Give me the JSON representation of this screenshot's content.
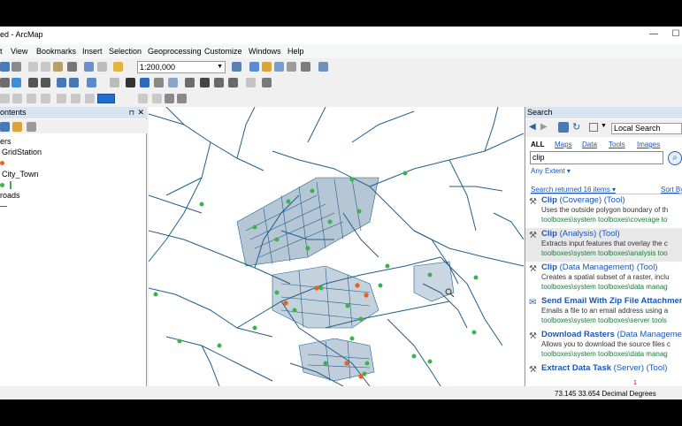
{
  "window": {
    "title": "ed - ArcMap",
    "minimize_glyph": "—",
    "maximize_glyph": "☐"
  },
  "menu": [
    "t",
    "View",
    "Bookmarks",
    "Insert",
    "Selection",
    "Geoprocessing",
    "Customize",
    "Windows",
    "Help"
  ],
  "toolbar": {
    "scale_value": "1:200,000"
  },
  "toc": {
    "title": "ontents",
    "pin_glyph": "⊓",
    "close_glyph": "✕",
    "layers_label": "ers",
    "layers": [
      {
        "name": "GridStation",
        "symbol_color": "#3cb24a"
      },
      {
        "name": "City_Town",
        "symbol_color": "#e8641e"
      },
      {
        "name": "roads",
        "symbol_color": "#2b6cb0"
      }
    ]
  },
  "search": {
    "title": "Search",
    "scope": "Local Search",
    "tabs": [
      "ALL",
      "Maps",
      "Data",
      "Tools",
      "Images"
    ],
    "query": "clip",
    "extent_label": "Any Extent ▾",
    "returned_label": "Search returned 16 items ▾",
    "sort_label": "Sort By",
    "results": [
      {
        "name": "Clip",
        "suffix": " (Coverage) (Tool)",
        "desc": "Uses the outside polygon boundary of th",
        "path": "toolboxes\\system toolboxes\\coverage to",
        "selected": false
      },
      {
        "name": "Clip",
        "suffix": " (Analysis) (Tool)",
        "desc": "Extracts input features that overlay the c",
        "path": "toolboxes\\system toolboxes\\analysis too",
        "selected": true
      },
      {
        "name": "Clip",
        "suffix": " (Data Management) (Tool)",
        "desc": "Creates a spatial subset of a raster, inclu",
        "path": "toolboxes\\system toolboxes\\data manag",
        "selected": false
      },
      {
        "name": "Send Email With Zip File Attachment",
        "suffix": " (",
        "desc": "Emails a file to an email address using a",
        "path": "toolboxes\\system toolboxes\\server tools",
        "selected": false
      },
      {
        "name": "Download Rasters",
        "suffix": " (Data Managemen",
        "desc": "Allows you to download the source files c",
        "path": "toolboxes\\system toolboxes\\data manag",
        "selected": false
      },
      {
        "name": "Extract Data Task",
        "suffix": " (Server) (Tool)",
        "desc": "",
        "path": "",
        "selected": false
      }
    ]
  },
  "status": {
    "coordinates": "73.145  33.654 Decimal Degrees",
    "page_marker": "1"
  },
  "colors": {
    "roads": "#1f5f8b",
    "grid_station": "#3cb24a",
    "city_town": "#e8641e"
  }
}
